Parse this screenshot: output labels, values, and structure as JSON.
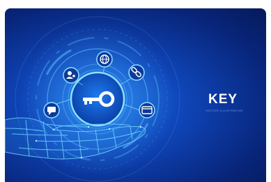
{
  "illustration": {
    "title": "KEY",
    "subtitle": "VECTOR ILLUSTRATION",
    "center_icon": "key-icon",
    "orbit_icons": [
      "chat-icon",
      "user-icon",
      "globe-icon",
      "link-icon",
      "card-icon"
    ],
    "colors": {
      "background_dark": "#061a5a",
      "background_light": "#1f6fe0",
      "glow": "#6fd3ff",
      "title": "#ffffff"
    }
  }
}
